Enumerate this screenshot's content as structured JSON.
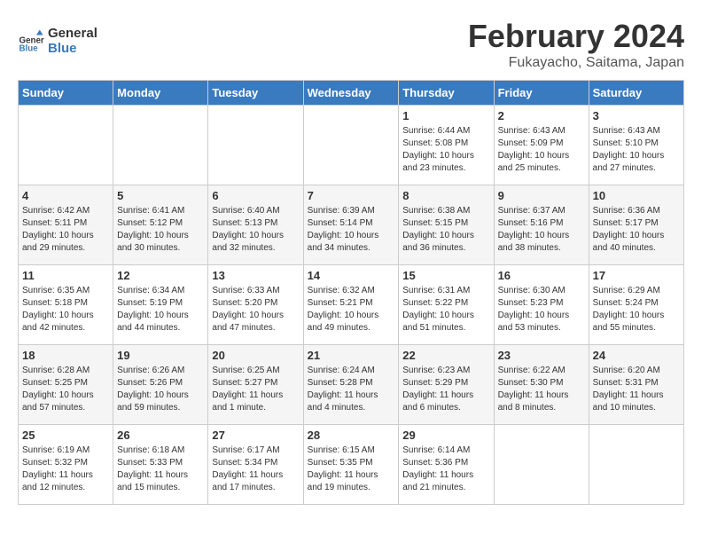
{
  "header": {
    "logo_line1": "General",
    "logo_line2": "Blue",
    "title": "February 2024",
    "subtitle": "Fukayacho, Saitama, Japan"
  },
  "days_of_week": [
    "Sunday",
    "Monday",
    "Tuesday",
    "Wednesday",
    "Thursday",
    "Friday",
    "Saturday"
  ],
  "weeks": [
    [
      {
        "num": "",
        "info": ""
      },
      {
        "num": "",
        "info": ""
      },
      {
        "num": "",
        "info": ""
      },
      {
        "num": "",
        "info": ""
      },
      {
        "num": "1",
        "info": "Sunrise: 6:44 AM\nSunset: 5:08 PM\nDaylight: 10 hours\nand 23 minutes."
      },
      {
        "num": "2",
        "info": "Sunrise: 6:43 AM\nSunset: 5:09 PM\nDaylight: 10 hours\nand 25 minutes."
      },
      {
        "num": "3",
        "info": "Sunrise: 6:43 AM\nSunset: 5:10 PM\nDaylight: 10 hours\nand 27 minutes."
      }
    ],
    [
      {
        "num": "4",
        "info": "Sunrise: 6:42 AM\nSunset: 5:11 PM\nDaylight: 10 hours\nand 29 minutes."
      },
      {
        "num": "5",
        "info": "Sunrise: 6:41 AM\nSunset: 5:12 PM\nDaylight: 10 hours\nand 30 minutes."
      },
      {
        "num": "6",
        "info": "Sunrise: 6:40 AM\nSunset: 5:13 PM\nDaylight: 10 hours\nand 32 minutes."
      },
      {
        "num": "7",
        "info": "Sunrise: 6:39 AM\nSunset: 5:14 PM\nDaylight: 10 hours\nand 34 minutes."
      },
      {
        "num": "8",
        "info": "Sunrise: 6:38 AM\nSunset: 5:15 PM\nDaylight: 10 hours\nand 36 minutes."
      },
      {
        "num": "9",
        "info": "Sunrise: 6:37 AM\nSunset: 5:16 PM\nDaylight: 10 hours\nand 38 minutes."
      },
      {
        "num": "10",
        "info": "Sunrise: 6:36 AM\nSunset: 5:17 PM\nDaylight: 10 hours\nand 40 minutes."
      }
    ],
    [
      {
        "num": "11",
        "info": "Sunrise: 6:35 AM\nSunset: 5:18 PM\nDaylight: 10 hours\nand 42 minutes."
      },
      {
        "num": "12",
        "info": "Sunrise: 6:34 AM\nSunset: 5:19 PM\nDaylight: 10 hours\nand 44 minutes."
      },
      {
        "num": "13",
        "info": "Sunrise: 6:33 AM\nSunset: 5:20 PM\nDaylight: 10 hours\nand 47 minutes."
      },
      {
        "num": "14",
        "info": "Sunrise: 6:32 AM\nSunset: 5:21 PM\nDaylight: 10 hours\nand 49 minutes."
      },
      {
        "num": "15",
        "info": "Sunrise: 6:31 AM\nSunset: 5:22 PM\nDaylight: 10 hours\nand 51 minutes."
      },
      {
        "num": "16",
        "info": "Sunrise: 6:30 AM\nSunset: 5:23 PM\nDaylight: 10 hours\nand 53 minutes."
      },
      {
        "num": "17",
        "info": "Sunrise: 6:29 AM\nSunset: 5:24 PM\nDaylight: 10 hours\nand 55 minutes."
      }
    ],
    [
      {
        "num": "18",
        "info": "Sunrise: 6:28 AM\nSunset: 5:25 PM\nDaylight: 10 hours\nand 57 minutes."
      },
      {
        "num": "19",
        "info": "Sunrise: 6:26 AM\nSunset: 5:26 PM\nDaylight: 10 hours\nand 59 minutes."
      },
      {
        "num": "20",
        "info": "Sunrise: 6:25 AM\nSunset: 5:27 PM\nDaylight: 11 hours\nand 1 minute."
      },
      {
        "num": "21",
        "info": "Sunrise: 6:24 AM\nSunset: 5:28 PM\nDaylight: 11 hours\nand 4 minutes."
      },
      {
        "num": "22",
        "info": "Sunrise: 6:23 AM\nSunset: 5:29 PM\nDaylight: 11 hours\nand 6 minutes."
      },
      {
        "num": "23",
        "info": "Sunrise: 6:22 AM\nSunset: 5:30 PM\nDaylight: 11 hours\nand 8 minutes."
      },
      {
        "num": "24",
        "info": "Sunrise: 6:20 AM\nSunset: 5:31 PM\nDaylight: 11 hours\nand 10 minutes."
      }
    ],
    [
      {
        "num": "25",
        "info": "Sunrise: 6:19 AM\nSunset: 5:32 PM\nDaylight: 11 hours\nand 12 minutes."
      },
      {
        "num": "26",
        "info": "Sunrise: 6:18 AM\nSunset: 5:33 PM\nDaylight: 11 hours\nand 15 minutes."
      },
      {
        "num": "27",
        "info": "Sunrise: 6:17 AM\nSunset: 5:34 PM\nDaylight: 11 hours\nand 17 minutes."
      },
      {
        "num": "28",
        "info": "Sunrise: 6:15 AM\nSunset: 5:35 PM\nDaylight: 11 hours\nand 19 minutes."
      },
      {
        "num": "29",
        "info": "Sunrise: 6:14 AM\nSunset: 5:36 PM\nDaylight: 11 hours\nand 21 minutes."
      },
      {
        "num": "",
        "info": ""
      },
      {
        "num": "",
        "info": ""
      }
    ]
  ]
}
